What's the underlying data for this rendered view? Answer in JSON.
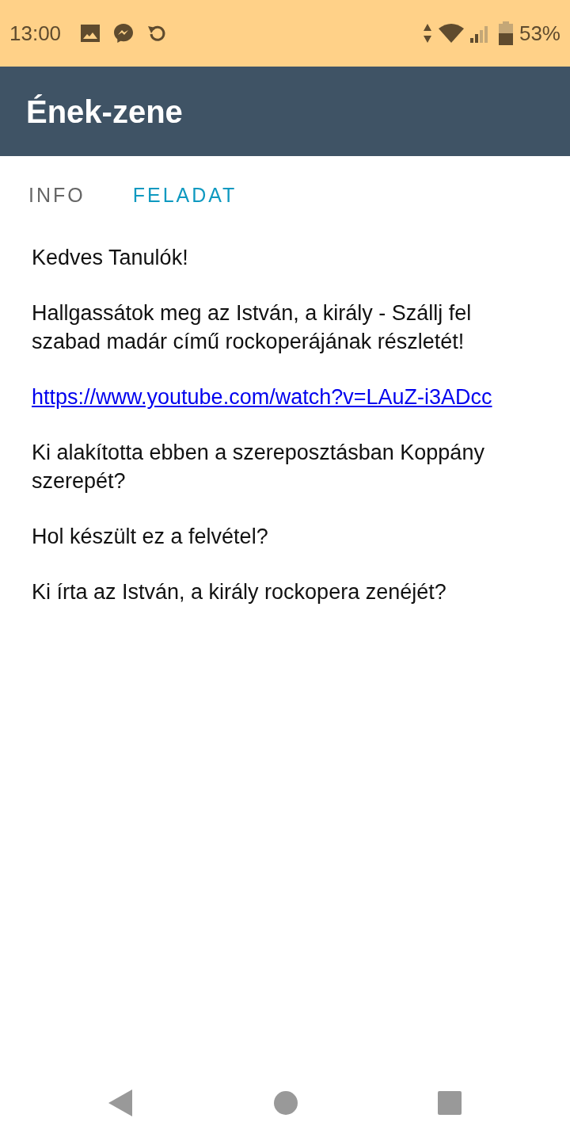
{
  "status_bar": {
    "time": "13:00",
    "battery": "53%"
  },
  "app_bar": {
    "title": "Ének-zene"
  },
  "tabs": [
    {
      "label": "INFO",
      "selected": false
    },
    {
      "label": "FELADAT",
      "selected": true
    }
  ],
  "content": [
    {
      "kind": "text",
      "text": "Kedves Tanulók!"
    },
    {
      "kind": "text",
      "text": "Hallgassátok meg az István, a király - Szállj fel szabad madár című rockoperájának részletét!"
    },
    {
      "kind": "link",
      "text": "https://www.youtube.com/watch?v=LAuZ-i3ADcc"
    },
    {
      "kind": "text",
      "text": "Ki alakította ebben a szereposztásban Koppány szerepét?"
    },
    {
      "kind": "text",
      "text": "Hol készült ez a felvétel?"
    },
    {
      "kind": "text",
      "text": "Ki írta az István, a király rockopera zenéjét?"
    }
  ]
}
